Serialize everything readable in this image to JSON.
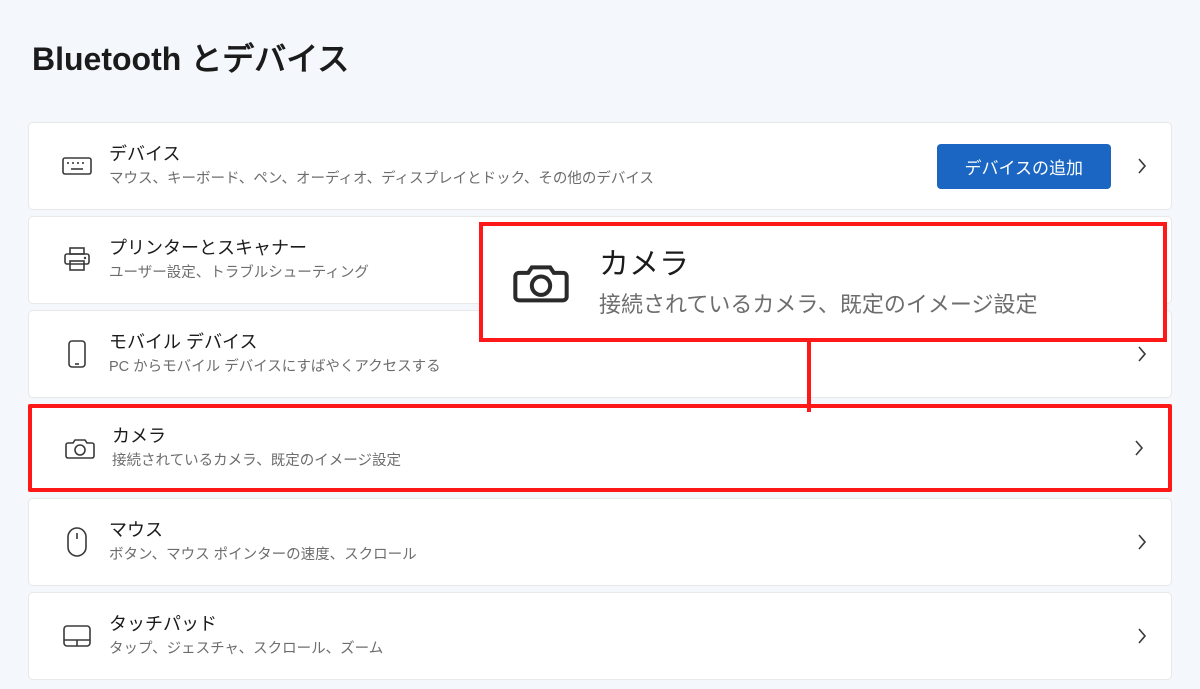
{
  "page_title": "Bluetooth とデバイス",
  "rows": {
    "devices": {
      "label": "デバイス",
      "desc": "マウス、キーボード、ペン、オーディオ、ディスプレイとドック、その他のデバイス",
      "add_button": "デバイスの追加"
    },
    "printers": {
      "label": "プリンターとスキャナー",
      "desc": "ユーザー設定、トラブルシューティング"
    },
    "mobile": {
      "label": "モバイル デバイス",
      "desc": "PC からモバイル デバイスにすばやくアクセスする"
    },
    "camera": {
      "label": "カメラ",
      "desc": "接続されているカメラ、既定のイメージ設定"
    },
    "mouse": {
      "label": "マウス",
      "desc": "ボタン、マウス ポインターの速度、スクロール"
    },
    "touchpad": {
      "label": "タッチパッド",
      "desc": "タップ、ジェスチャ、スクロール、ズーム"
    }
  },
  "callout": {
    "label": "カメラ",
    "desc": "接続されているカメラ、既定のイメージ設定"
  }
}
